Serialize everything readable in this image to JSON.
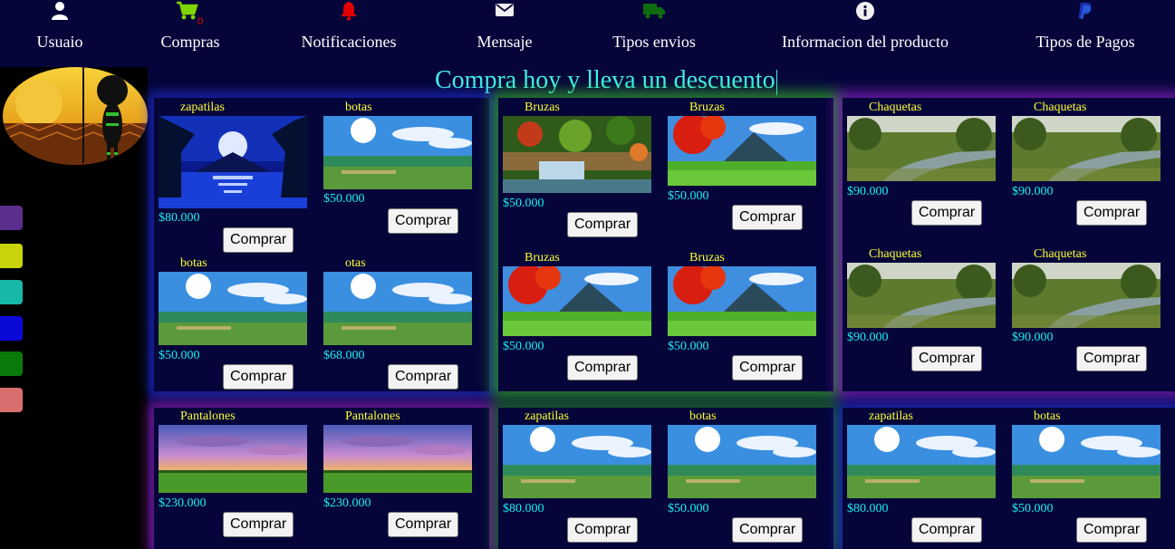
{
  "nav": {
    "usuario": "Usuaio",
    "compras": "Compras",
    "cart_count": "0",
    "notificaciones": "Notificaciones",
    "mensaje": "Mensaje",
    "tipos_envios": "Tipos envios",
    "informacion": "Informacion del producto",
    "tipos_pagos": "Tipos de Pagos"
  },
  "colors": {
    "background": "#05053a",
    "accent_cyan": "#3ff0e6",
    "name_yellow": "#ffff33",
    "price_cyan": "#19f0f0",
    "swatches": [
      "#5b2d8c",
      "#c7d40b",
      "#17b8a8",
      "#0a0ad8",
      "#0a7a0a",
      "#d86e6e"
    ]
  },
  "headline": "Compra hoy y lleva un descuento",
  "buy_label": "Comprar",
  "cards": [
    {
      "name": "zapatilas",
      "price": "$80.000"
    },
    {
      "name": "botas",
      "price": "$50.000"
    },
    {
      "name": "botas",
      "price": "$50.000"
    },
    {
      "name": "otas",
      "price": "$68.000"
    },
    {
      "name": "Bruzas",
      "price": "$50.000"
    },
    {
      "name": "Bruzas",
      "price": "$50.000"
    },
    {
      "name": "Bruzas",
      "price": "$50.000"
    },
    {
      "name": "Bruzas",
      "price": "$50.000"
    },
    {
      "name": "Chaquetas",
      "price": "$90.000"
    },
    {
      "name": "Chaquetas",
      "price": "$90.000"
    },
    {
      "name": "Chaquetas",
      "price": "$90.000"
    },
    {
      "name": "Chaquetas",
      "price": "$90.000"
    },
    {
      "name": "Pantalones",
      "price": "$230.000"
    },
    {
      "name": "Pantalones",
      "price": "$230.000"
    },
    {
      "name": "zapatilas",
      "price": "$80.000"
    },
    {
      "name": "botas",
      "price": "$50.000"
    },
    {
      "name": "zapatilas",
      "price": "$80.000"
    },
    {
      "name": "botas",
      "price": "$50.000"
    }
  ]
}
